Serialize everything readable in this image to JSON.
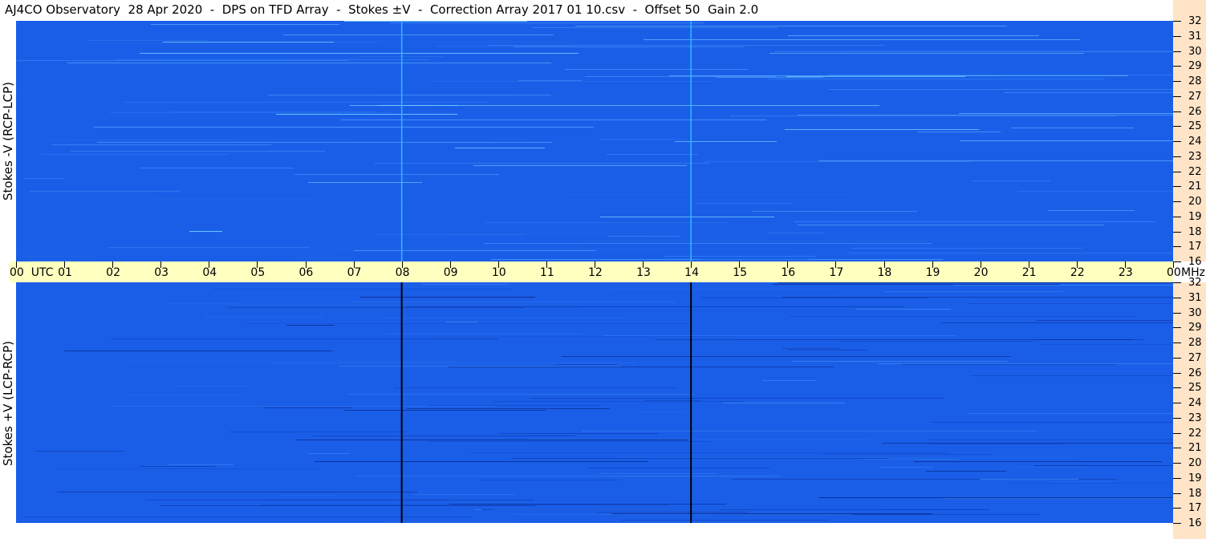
{
  "title": "AJ4CO Observatory  28 Apr 2020  -  DPS on TFD Array  -  Stokes ±V  -  Correction Array 2017 01 10.csv  -  Offset 50  Gain 2.0",
  "colors": {
    "background": "#1a5ee8",
    "time_band": "#ffffc0",
    "freq_strip": "#ffe4c8"
  },
  "chart_data": {
    "type": "heatmap",
    "title": "AJ4CO Observatory  28 Apr 2020  -  DPS on TFD Array  -  Stokes ±V  -  Correction Array 2017 01 10.csv  -  Offset 50  Gain 2.0",
    "time_labels": [
      "00  UTC",
      "01",
      "02",
      "03",
      "04",
      "05",
      "06",
      "07",
      "08",
      "09",
      "10",
      "11",
      "12",
      "13",
      "14",
      "15",
      "16",
      "17",
      "18",
      "19",
      "20",
      "21",
      "22",
      "23",
      "00"
    ],
    "time_unit": "",
    "freq_labels": [
      "32",
      "31",
      "30",
      "29",
      "28",
      "27",
      "26",
      "25",
      "24",
      "23",
      "22",
      "21",
      "20",
      "19",
      "18",
      "17",
      "16"
    ],
    "freq_unit": "MHz",
    "panels": [
      {
        "ylabel": "Stokes -V (RCP-LCP)",
        "ylim": [
          16,
          32
        ],
        "marker_hours": [
          8,
          14
        ],
        "marker_color": "#30b8ff"
      },
      {
        "ylabel": "Stokes +V (LCP-RCP)",
        "ylim": [
          16,
          32
        ],
        "marker_hours": [
          8,
          14
        ],
        "marker_color": "#000000"
      }
    ]
  }
}
